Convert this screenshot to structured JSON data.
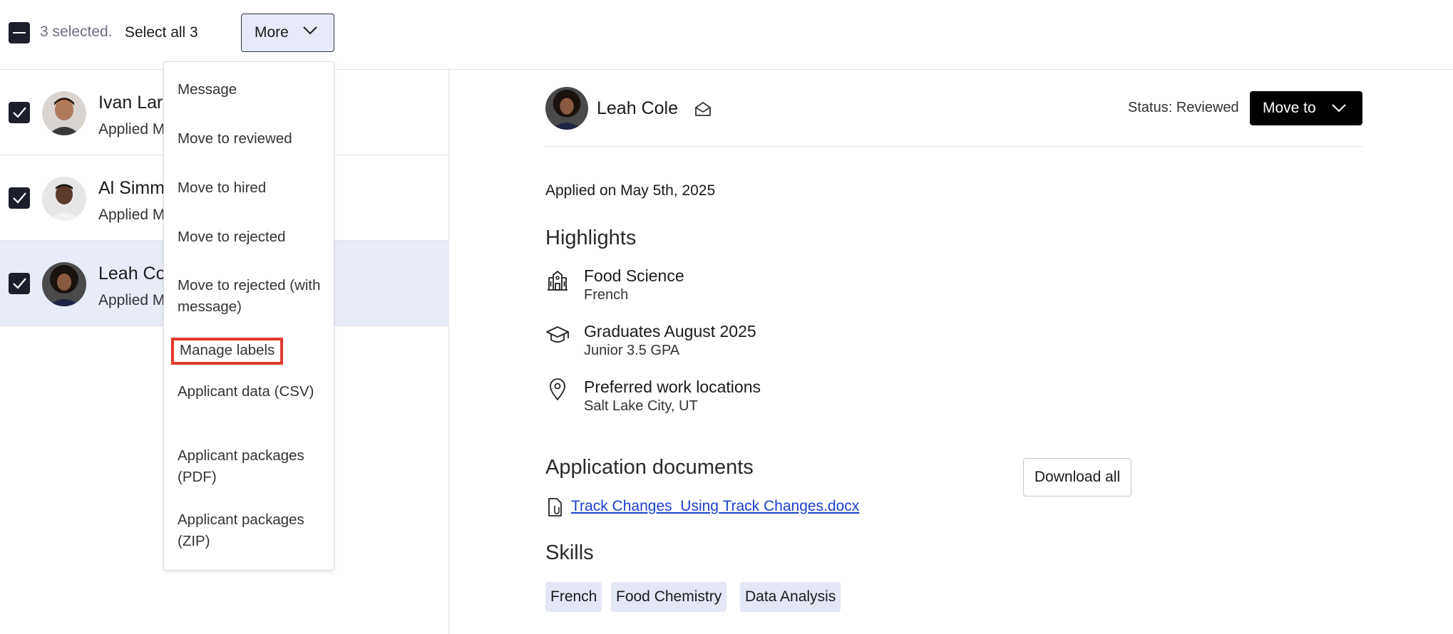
{
  "topbar": {
    "selected_text": "3 selected.",
    "select_all_label": "Select all 3",
    "more_label": "More"
  },
  "applicants": [
    {
      "name": "Ivan Lars",
      "sub": "Applied M"
    },
    {
      "name": "Al Simm",
      "sub": "Applied M"
    },
    {
      "name": "Leah Co",
      "sub": "Applied M"
    }
  ],
  "dropdown": {
    "items": [
      "Message",
      "Move to reviewed",
      "Move to hired",
      "Move to rejected",
      "Move to rejected (with message)",
      "Manage labels",
      "Applicant data (CSV)",
      "Applicant packages (PDF)",
      "Applicant packages (ZIP)"
    ]
  },
  "detail": {
    "name": "Leah Cole",
    "status": "Status: Reviewed",
    "move_to_label": "Move to",
    "applied_on": "Applied on May 5th, 2025",
    "highlights_heading": "Highlights",
    "highlights": [
      {
        "icon": "building-icon",
        "title": "Food Science",
        "sub": "French"
      },
      {
        "icon": "graduation-cap-icon",
        "title": "Graduates August 2025",
        "sub": "Junior  3.5 GPA"
      },
      {
        "icon": "location-pin-icon",
        "title": "Preferred work locations",
        "sub": "Salt Lake City, UT"
      }
    ],
    "documents_heading": "Application documents",
    "download_all_label": "Download all",
    "document_link": "Track Changes_Using Track Changes.docx",
    "skills_heading": "Skills",
    "skills": [
      "French",
      "Food Chemistry",
      "Data Analysis"
    ]
  },
  "colors": {
    "accent_bg": "#e7eaf8",
    "checkbox": "#1c1f2b",
    "link": "#1a3fd0",
    "highlight_border": "#e03a2c"
  }
}
